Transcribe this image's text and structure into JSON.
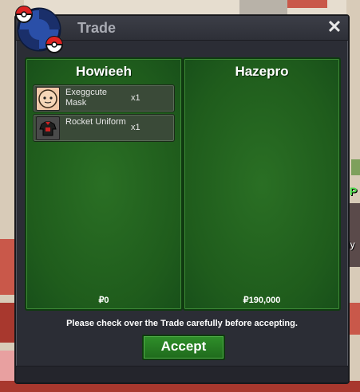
{
  "window": {
    "title": "Trade"
  },
  "close_glyph": "✕",
  "left": {
    "name": "Howieeh",
    "items": [
      {
        "name": "Exeggcute Mask",
        "qty": "x1",
        "icon": "exeggcute-mask-icon"
      },
      {
        "name": "Rocket Uniform",
        "qty": "x1",
        "icon": "rocket-uniform-icon"
      }
    ],
    "money": "₽0"
  },
  "right": {
    "name": "Hazepro",
    "items": [],
    "money": "₽190,000"
  },
  "notice": "Please check over the Trade carefully before accepting.",
  "accept_label": "Accept",
  "background": {
    "npc_label": "P",
    "npc_text": "ly"
  },
  "colors": {
    "panel_green": "#1f5c1c",
    "accept_green": "#2f8f2a",
    "window": "#2b2d35"
  }
}
